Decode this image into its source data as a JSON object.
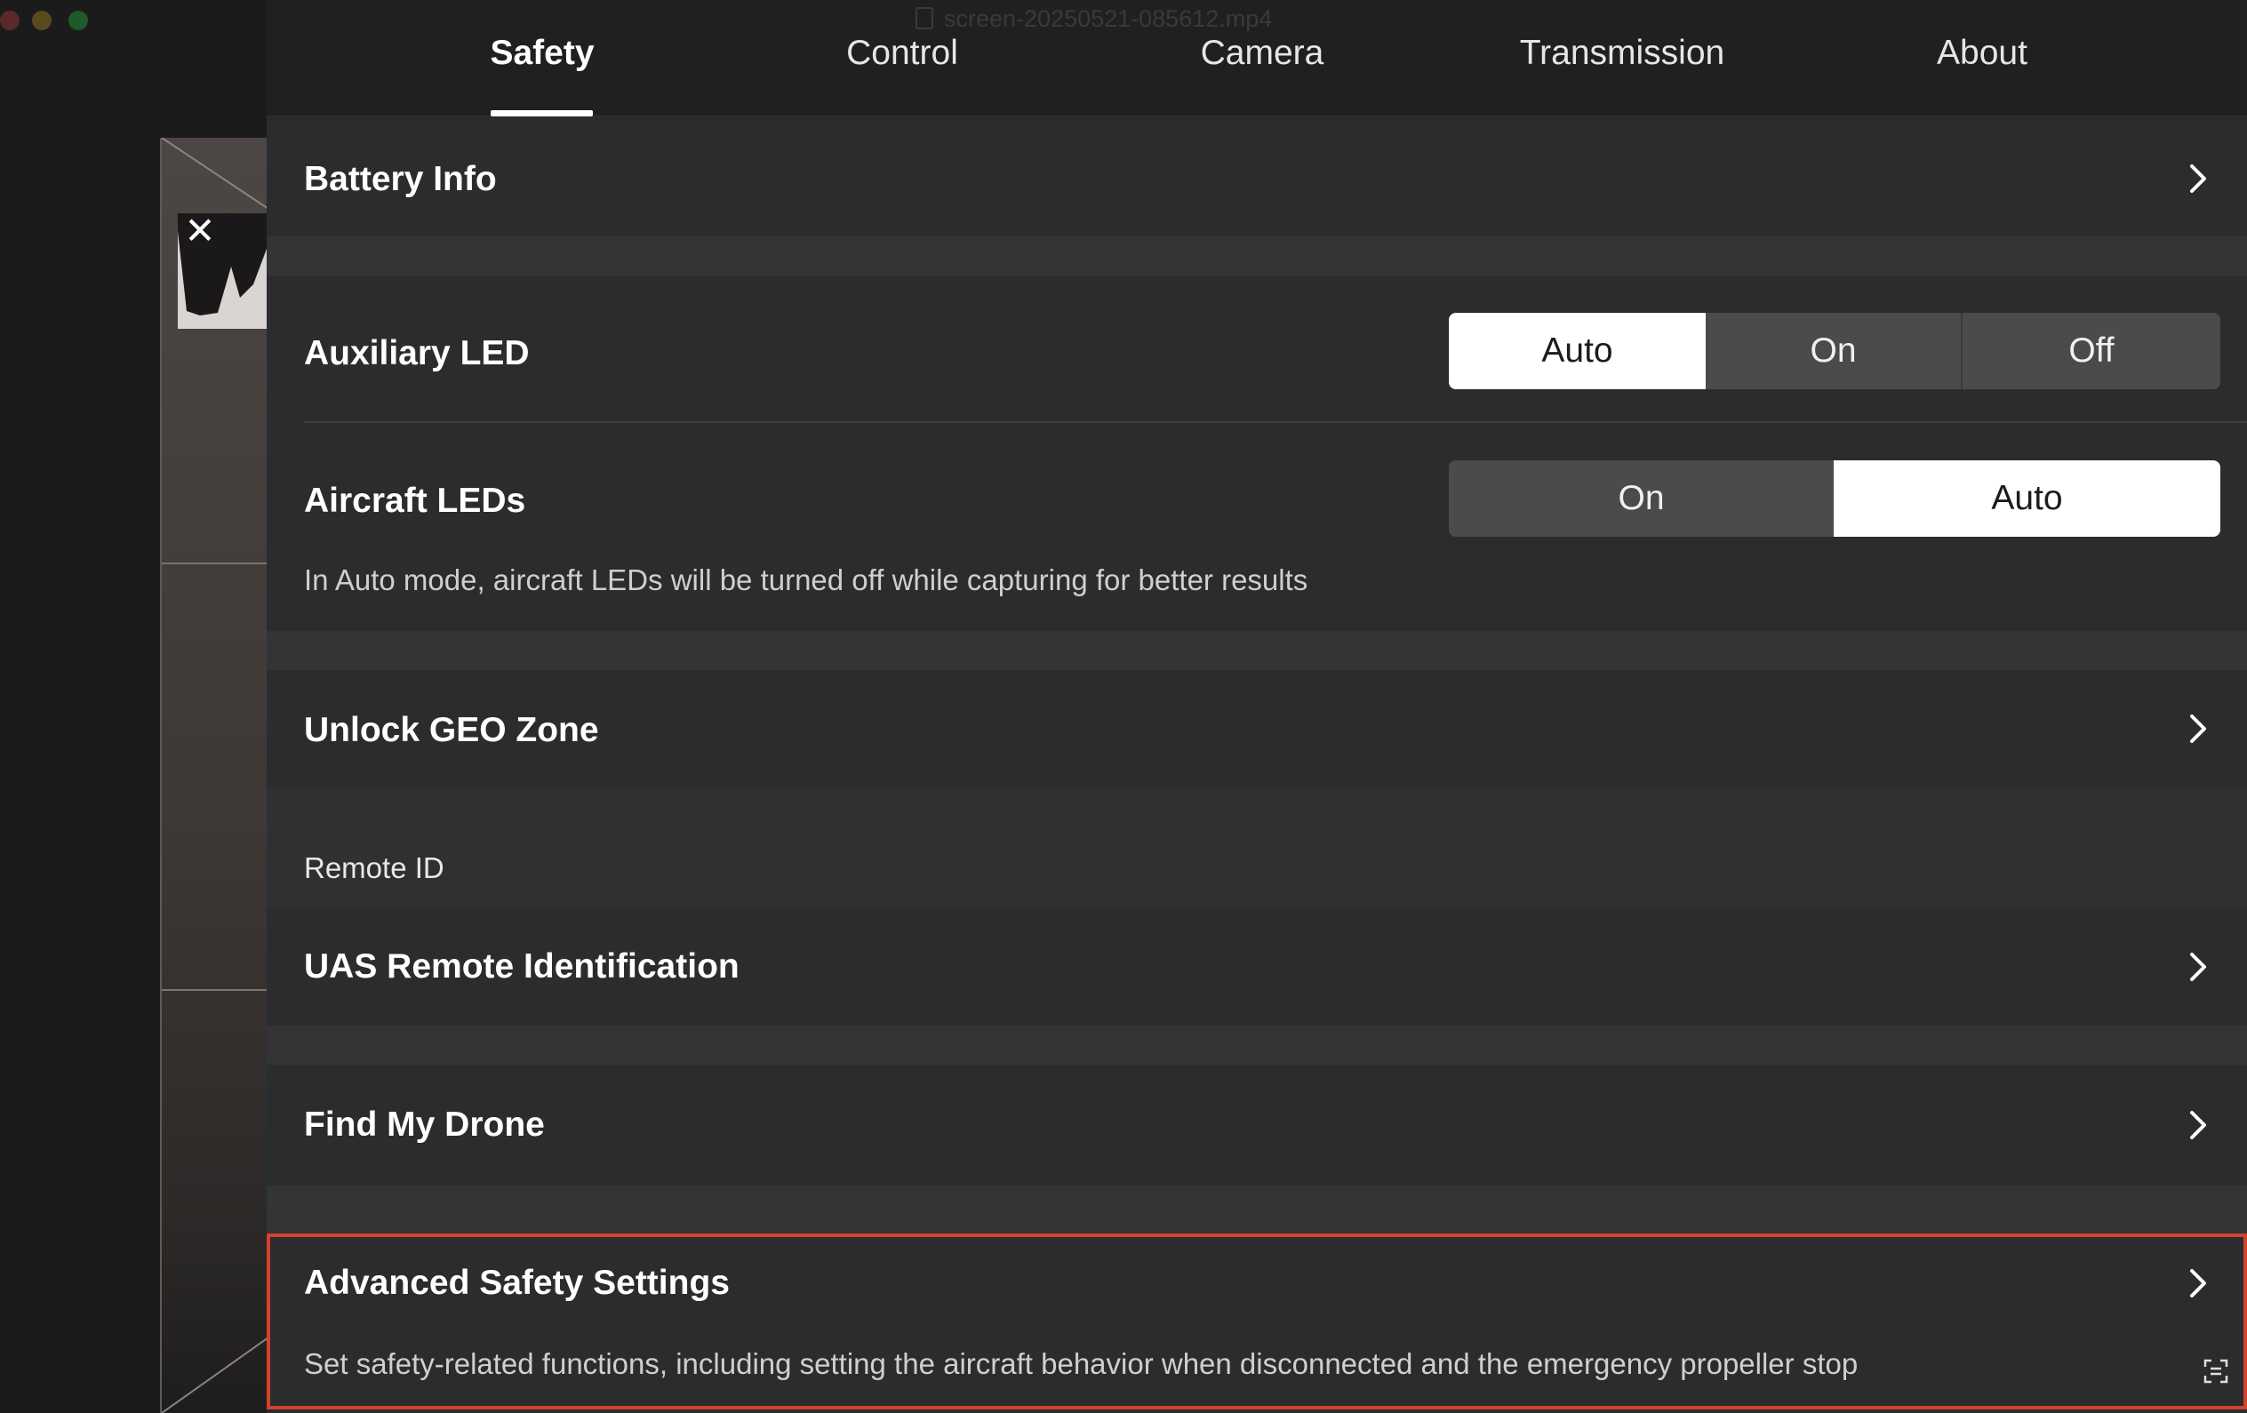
{
  "window": {
    "title": "screen-20250521-085612.mp4"
  },
  "tabs": [
    {
      "label": "Safety",
      "active": true
    },
    {
      "label": "Control",
      "active": false
    },
    {
      "label": "Camera",
      "active": false
    },
    {
      "label": "Transmission",
      "active": false
    },
    {
      "label": "About",
      "active": false
    }
  ],
  "battery_info": {
    "label": "Battery Info"
  },
  "auxiliary_led": {
    "label": "Auxiliary LED",
    "options": [
      "Auto",
      "On",
      "Off"
    ],
    "selected": "Auto"
  },
  "aircraft_leds": {
    "label": "Aircraft LEDs",
    "options": [
      "On",
      "Auto"
    ],
    "selected": "Auto",
    "description": "In Auto mode, aircraft LEDs will be turned off while capturing for better results"
  },
  "unlock_geo_zone": {
    "label": "Unlock GEO Zone"
  },
  "remote_id": {
    "section_label": "Remote ID",
    "uas": {
      "label": "UAS Remote Identification"
    }
  },
  "find_my_drone": {
    "label": "Find My Drone"
  },
  "advanced_safety": {
    "label": "Advanced Safety Settings",
    "description": "Set safety-related functions, including setting the aircraft behavior when disconnected and the emergency propeller stop",
    "highlight_color": "#d6402f"
  },
  "icons": {
    "chevron": "chevron-right-icon",
    "close": "close-icon",
    "screenshot": "screenshot-icon"
  }
}
